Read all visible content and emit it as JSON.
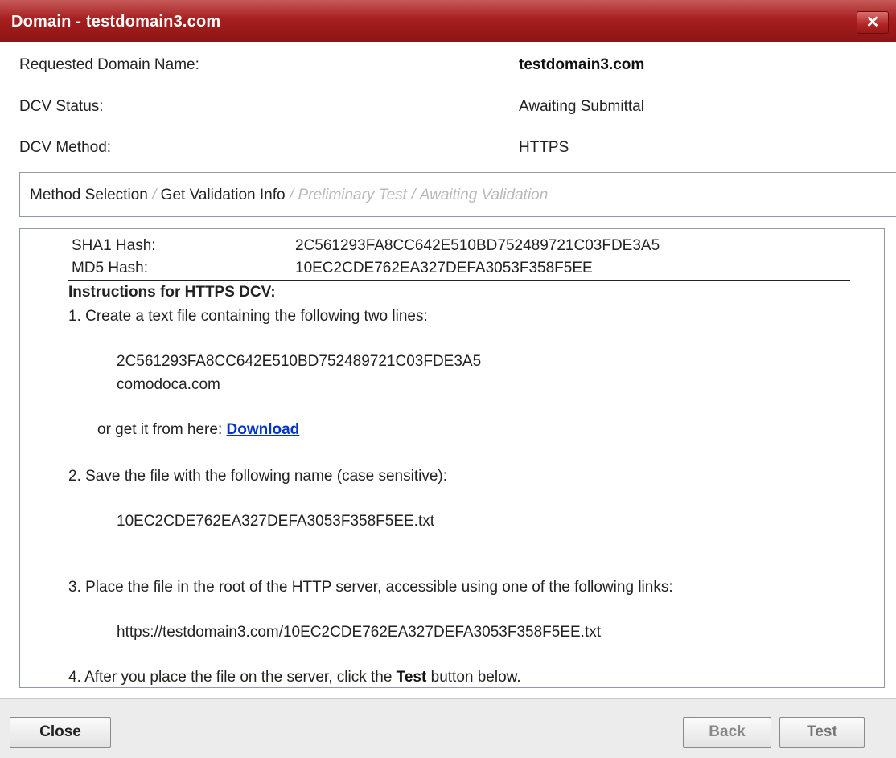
{
  "window": {
    "title": "Domain - testdomain3.com",
    "close_glyph": "✕"
  },
  "info": {
    "requested_domain_label": "Requested Domain Name:",
    "requested_domain_value": "testdomain3.com",
    "dcv_status_label": "DCV Status:",
    "dcv_status_value": "Awaiting Submittal",
    "dcv_method_label": "DCV Method:",
    "dcv_method_value": "HTTPS"
  },
  "breadcrumb": {
    "step1": "Method Selection",
    "sep1": " /",
    "step2": "Get Validation Info",
    "sep2": " /",
    "step3": "Preliminary Test",
    "sep3": " /",
    "step4": "Awaiting Validation"
  },
  "hashes": {
    "sha1_label": "SHA1 Hash:",
    "sha1_value": "2C561293FA8CC642E510BD752489721C03FDE3A5",
    "md5_label": "MD5 Hash:",
    "md5_value": "10EC2CDE762EA327DEFA3053F358F5EE"
  },
  "instructions": {
    "heading": "Instructions for HTTPS DCV:",
    "step1": "1. Create a text file containing the following two lines:",
    "line1": "2C561293FA8CC642E510BD752489721C03FDE3A5",
    "line2": "comodoca.com",
    "download_prefix": "or get it from here: ",
    "download_link": "Download",
    "step2": "2. Save the file with the following name (case sensitive):",
    "filename": "10EC2CDE762EA327DEFA3053F358F5EE.txt",
    "step3": "3. Place the file in the root of the HTTP server, accessible using one of the following links:",
    "url": "https://testdomain3.com/10EC2CDE762EA327DEFA3053F358F5EE.txt",
    "step4_prefix": "4. After you place the file on the server, click the ",
    "step4_bold": "Test",
    "step4_suffix": " button below."
  },
  "footer": {
    "close_label": "Close",
    "back_label": "Back",
    "test_label": "Test"
  },
  "colors": {
    "titlebar": "#a71f1f",
    "link": "#0033cc",
    "muted_step": "#b9b9b9"
  }
}
